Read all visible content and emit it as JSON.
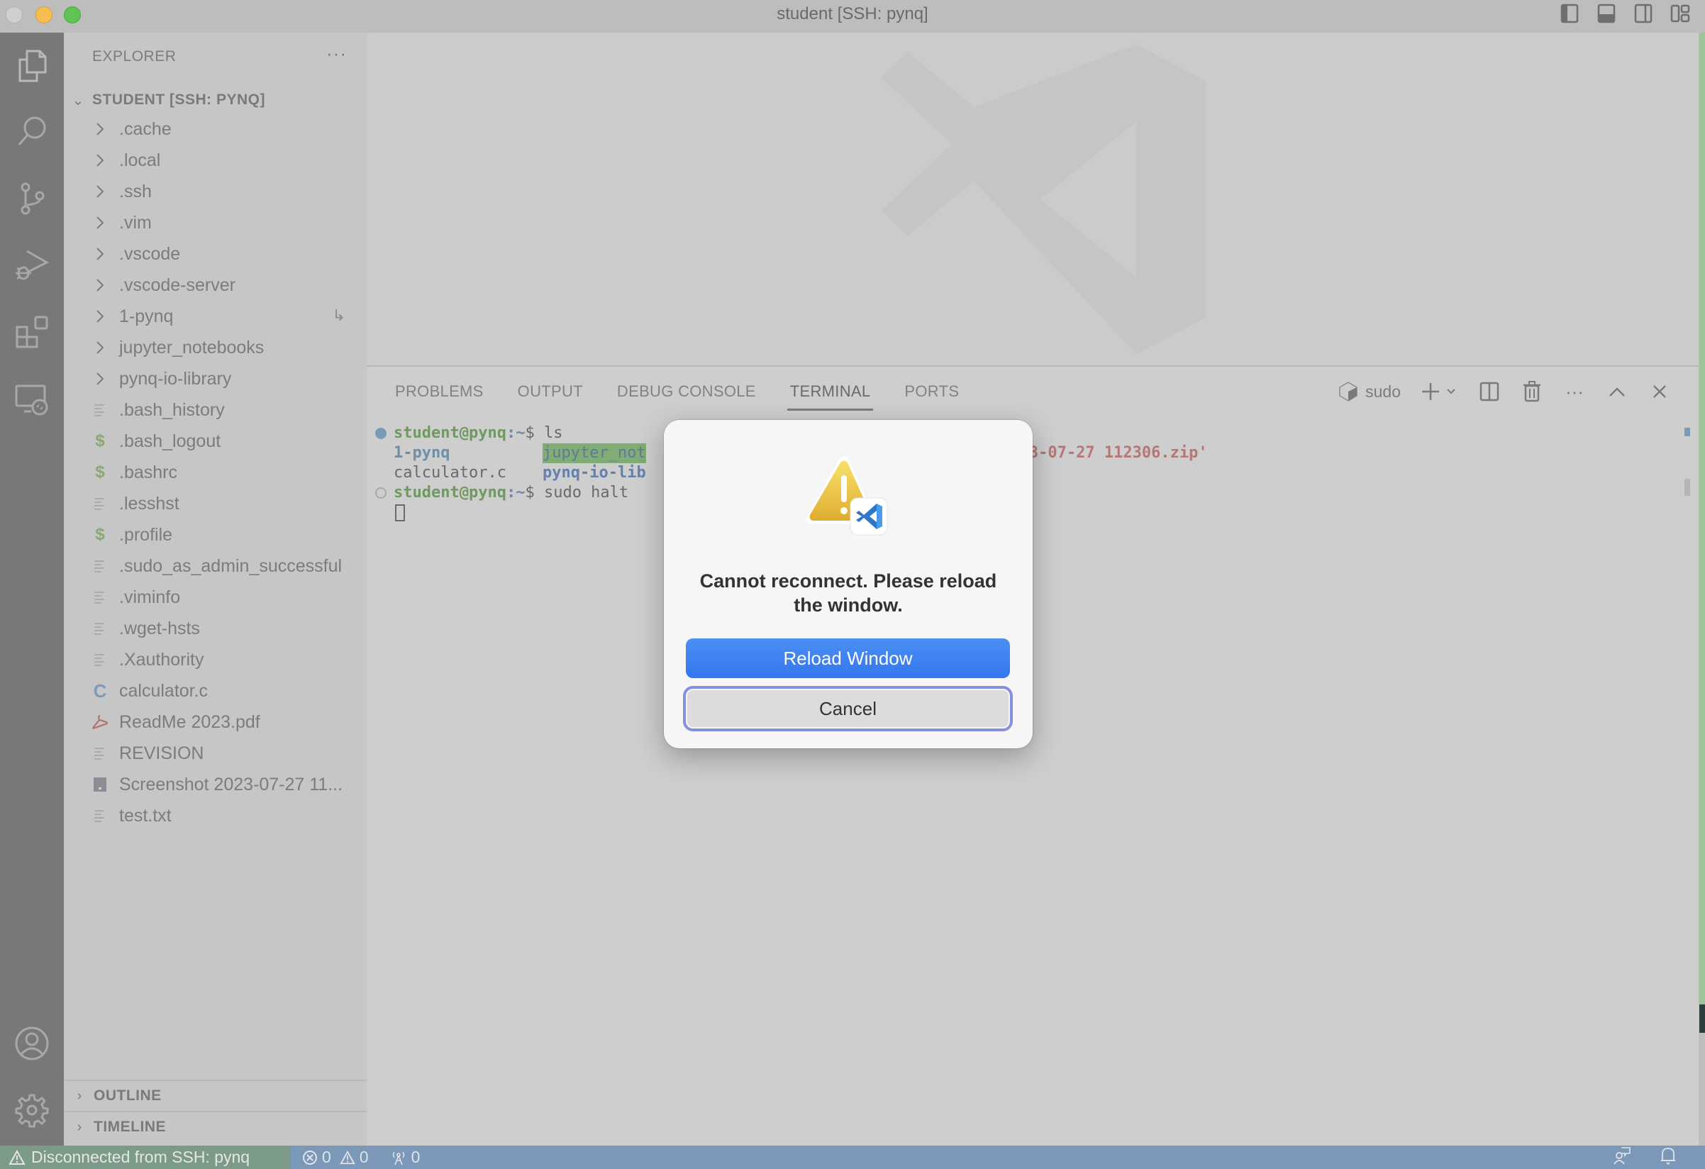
{
  "window": {
    "title": "student [SSH: pynq]",
    "layout_controls": [
      "toggle-primary-sidebar",
      "toggle-panel",
      "toggle-secondary-sidebar",
      "customize-layout"
    ]
  },
  "activity_bar": {
    "top": [
      "explorer",
      "search",
      "source-control",
      "run-and-debug",
      "extensions",
      "remote-explorer"
    ],
    "bottom": [
      "accounts",
      "manage"
    ]
  },
  "sidebar": {
    "header": "EXPLORER",
    "more_label": "···",
    "root_label": "STUDENT [SSH: PYNQ]",
    "items": [
      {
        "name": ".cache",
        "type": "folder"
      },
      {
        "name": ".local",
        "type": "folder"
      },
      {
        "name": ".ssh",
        "type": "folder"
      },
      {
        "name": ".vim",
        "type": "folder"
      },
      {
        "name": ".vscode",
        "type": "folder"
      },
      {
        "name": ".vscode-server",
        "type": "folder"
      },
      {
        "name": "1-pynq",
        "type": "folder",
        "badge": "↳"
      },
      {
        "name": "jupyter_notebooks",
        "type": "folder"
      },
      {
        "name": "pynq-io-library",
        "type": "folder"
      },
      {
        "name": ".bash_history",
        "type": "text"
      },
      {
        "name": ".bash_logout",
        "type": "shell"
      },
      {
        "name": ".bashrc",
        "type": "shell"
      },
      {
        "name": ".lesshst",
        "type": "text"
      },
      {
        "name": ".profile",
        "type": "shell"
      },
      {
        "name": ".sudo_as_admin_successful",
        "type": "text"
      },
      {
        "name": ".viminfo",
        "type": "text"
      },
      {
        "name": ".wget-hsts",
        "type": "text"
      },
      {
        "name": ".Xauthority",
        "type": "text"
      },
      {
        "name": "calculator.c",
        "type": "c"
      },
      {
        "name": "ReadMe 2023.pdf",
        "type": "pdf"
      },
      {
        "name": "REVISION",
        "type": "text"
      },
      {
        "name": "Screenshot 2023-07-27 11...",
        "type": "image"
      },
      {
        "name": "test.txt",
        "type": "text"
      }
    ],
    "sections": [
      {
        "label": "OUTLINE"
      },
      {
        "label": "TIMELINE"
      }
    ]
  },
  "panel": {
    "tabs": [
      {
        "label": "PROBLEMS",
        "active": false
      },
      {
        "label": "OUTPUT",
        "active": false
      },
      {
        "label": "DEBUG CONSOLE",
        "active": false
      },
      {
        "label": "TERMINAL",
        "active": true
      },
      {
        "label": "PORTS",
        "active": false
      }
    ],
    "terminal_name": "sudo",
    "terminal": {
      "prompt_user": "student@pynq",
      "prompt_path": ":~",
      "prompt_sym": "$ ",
      "cmd1": "ls",
      "ls_col1_row1": "1-pynq",
      "ls_col2_row1": "jupyter_not",
      "ls_col1_row2": "calculator.c",
      "ls_col2_row2": "pynq-io-lib",
      "ls_tail_row1": "t 2023-07-27 112306.zip'",
      "cmd2": "sudo halt"
    }
  },
  "status_bar": {
    "remote": "Disconnected from SSH: pynq",
    "errors": "0",
    "warnings": "0",
    "ports": "0"
  },
  "dialog": {
    "message": "Cannot reconnect. Please reload the window.",
    "primary_button": "Reload Window",
    "cancel_button": "Cancel"
  },
  "colors": {
    "primary_button": "#3b82f0",
    "focus_ring": "#8790e0",
    "status_bar": "#7b98b8",
    "remote_indicator": "#7c9a88",
    "warning_icon": "#e8c04a"
  }
}
